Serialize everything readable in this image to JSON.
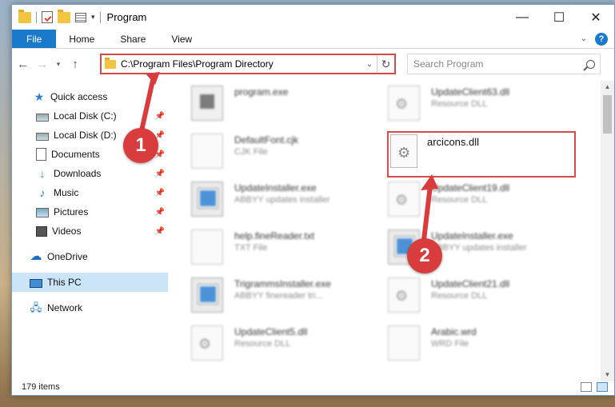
{
  "window": {
    "title": "Program",
    "controls": [
      "—",
      "☐",
      "✕"
    ]
  },
  "ribbon": {
    "tabs": [
      "File",
      "Home",
      "Share",
      "View"
    ],
    "help": "?"
  },
  "address_bar": {
    "path": "C:\\Program Files\\Program Directory"
  },
  "search": {
    "placeholder": "Search Program"
  },
  "sidebar": {
    "items": [
      {
        "label": "Quick access",
        "icon": "star-icon"
      },
      {
        "label": "Local Disk (C:)",
        "icon": "disk-icon",
        "pinned": true
      },
      {
        "label": "Local Disk (D:)",
        "icon": "disk-icon",
        "pinned": true
      },
      {
        "label": "Documents",
        "icon": "documents-icon",
        "pinned": true
      },
      {
        "label": "Downloads",
        "icon": "download-icon",
        "pinned": true
      },
      {
        "label": "Music",
        "icon": "music-icon",
        "pinned": true
      },
      {
        "label": "Pictures",
        "icon": "pictures-icon",
        "pinned": true
      },
      {
        "label": "Videos",
        "icon": "videos-icon",
        "pinned": true
      },
      {
        "label": "OneDrive",
        "icon": "cloud-icon"
      },
      {
        "label": "This PC",
        "icon": "pc-icon",
        "selected": true
      },
      {
        "label": "Network",
        "icon": "network-icon"
      }
    ]
  },
  "files": [
    {
      "name": "program.exe",
      "type": "",
      "icon": "app-icon"
    },
    {
      "name": "UpdateClient63.dll",
      "type": "Resource DLL",
      "icon": "dll-icon"
    },
    {
      "name": "DefaultFont.cjk",
      "type": "CJK File",
      "icon": "doc-icon"
    },
    {
      "name": "arcicons.dll",
      "type": "",
      "icon": "dll-icon",
      "highlighted": true
    },
    {
      "name": "UpdateInstaller.exe",
      "type": "ABBYY updates installer",
      "icon": "exe-icon"
    },
    {
      "name": "UpdateClient19.dll",
      "type": "Resource DLL",
      "icon": "dll-icon"
    },
    {
      "name": "help.fineReader.txt",
      "type": "TXT File",
      "icon": "doc-icon"
    },
    {
      "name": "UpdateInstaller.exe",
      "type": "ABBYY updates installer",
      "icon": "exe-icon"
    },
    {
      "name": "TrigrammsInstaller.exe",
      "type": "ABBYY finereader tri...",
      "icon": "exe-icon"
    },
    {
      "name": "UpdateClient21.dll",
      "type": "Resource DLL",
      "icon": "dll-icon"
    },
    {
      "name": "UpdateClient5.dll",
      "type": "Resource DLL",
      "icon": "dll-icon"
    },
    {
      "name": "Arabic.wrd",
      "type": "WRD File",
      "icon": "doc-icon"
    }
  ],
  "status": {
    "item_count": "179 items"
  },
  "annotations": {
    "step1": "1",
    "step2": "2"
  },
  "colors": {
    "accent": "#1979ca",
    "highlight": "#d94a4a",
    "selected_bg": "#cce4f7"
  }
}
